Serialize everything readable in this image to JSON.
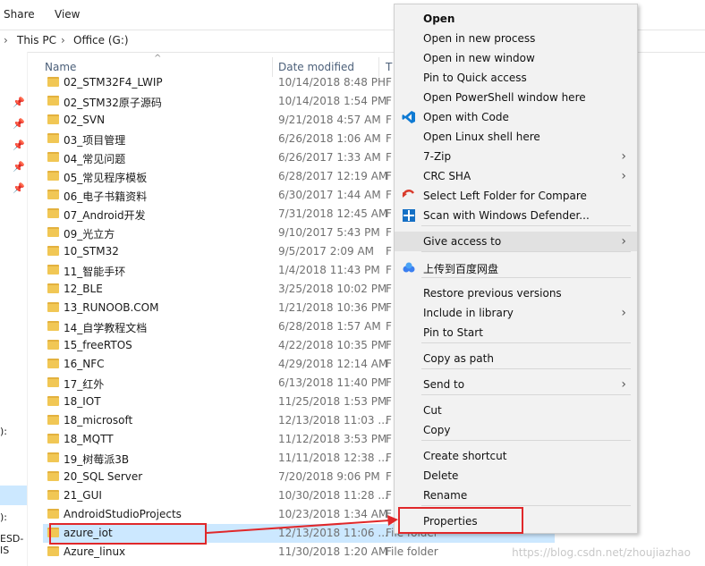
{
  "ribbon": {
    "tabs": [
      "Share",
      "View"
    ]
  },
  "address": {
    "chevron": "›",
    "segments": [
      "This PC",
      "Office (G:)"
    ]
  },
  "nav": {
    "labels": [
      "):",
      "):",
      "ESD-IS"
    ]
  },
  "columns": {
    "name": "Name",
    "date": "Date modified",
    "type": "T"
  },
  "files": [
    {
      "name": "02_STM32F4_LWIP",
      "date": "10/14/2018 8:48 PH",
      "type": "F"
    },
    {
      "name": "02_STM32原子源码",
      "date": "10/14/2018 1:54 PM",
      "type": "F"
    },
    {
      "name": "02_SVN",
      "date": "9/21/2018 4:57 AM",
      "type": "F"
    },
    {
      "name": "03_项目管理",
      "date": "6/26/2018 1:06 AM",
      "type": "F"
    },
    {
      "name": "04_常见问题",
      "date": "6/26/2017 1:33 AM",
      "type": "F"
    },
    {
      "name": "05_常见程序模板",
      "date": "6/28/2017 12:19 AM",
      "type": "F"
    },
    {
      "name": "06_电子书籍资料",
      "date": "6/30/2017 1:44 AM",
      "type": "F"
    },
    {
      "name": "07_Android开发",
      "date": "7/31/2018 12:45 AM",
      "type": "F"
    },
    {
      "name": "09_光立方",
      "date": "9/10/2017 5:43 PM",
      "type": "F"
    },
    {
      "name": "10_STM32",
      "date": "9/5/2017 2:09 AM",
      "type": "F"
    },
    {
      "name": "11_智能手环",
      "date": "1/4/2018 11:43 PM",
      "type": "F"
    },
    {
      "name": "12_BLE",
      "date": "3/25/2018 10:02 PM",
      "type": "F"
    },
    {
      "name": "13_RUNOOB.COM",
      "date": "1/21/2018 10:36 PM",
      "type": "F"
    },
    {
      "name": "14_自学教程文档",
      "date": "6/28/2018 1:57 AM",
      "type": "F"
    },
    {
      "name": "15_freeRTOS",
      "date": "4/22/2018 10:35 PM",
      "type": "F"
    },
    {
      "name": "16_NFC",
      "date": "4/29/2018 12:14 AM",
      "type": "F"
    },
    {
      "name": "17_红外",
      "date": "6/13/2018 11:40 PM",
      "type": "F"
    },
    {
      "name": "18_IOT",
      "date": "11/25/2018 1:53 PM",
      "type": "F"
    },
    {
      "name": "18_microsoft",
      "date": "12/13/2018 11:03 ...",
      "type": "F"
    },
    {
      "name": "18_MQTT",
      "date": "11/12/2018 3:53 PM",
      "type": "F"
    },
    {
      "name": "19_树莓派3B",
      "date": "11/11/2018 12:38 ...",
      "type": "F"
    },
    {
      "name": "20_SQL Server",
      "date": "7/20/2018 9:06 PM",
      "type": "F"
    },
    {
      "name": "21_GUI",
      "date": "10/30/2018 11:28 ...",
      "type": "F"
    },
    {
      "name": "AndroidStudioProjects",
      "date": "10/23/2018 1:34 AM",
      "type": "F"
    },
    {
      "name": "azure_iot",
      "date": "12/13/2018 11:06 ...",
      "type": "File folder",
      "selected": true
    },
    {
      "name": "Azure_linux",
      "date": "11/30/2018 1:20 AM",
      "type": "File folder"
    }
  ],
  "menu": {
    "items": [
      {
        "label": "Open",
        "bold": true
      },
      {
        "label": "Open in new process"
      },
      {
        "label": "Open in new window"
      },
      {
        "label": "Pin to Quick access"
      },
      {
        "label": "Open PowerShell window here"
      },
      {
        "label": "Open with Code",
        "icon": "vscode-icon"
      },
      {
        "label": "Open Linux shell here"
      },
      {
        "label": "7-Zip",
        "submenu": true
      },
      {
        "label": "CRC SHA",
        "submenu": true
      },
      {
        "label": "Select Left Folder for Compare",
        "icon": "compare-icon"
      },
      {
        "label": "Scan with Windows Defender...",
        "icon": "defender-icon"
      },
      {
        "sep": true
      },
      {
        "label": "Give access to",
        "submenu": true,
        "highlight": true
      },
      {
        "sep": true
      },
      {
        "label": "上传到百度网盘",
        "icon": "baidu-cloud-icon"
      },
      {
        "sep": true
      },
      {
        "label": "Restore previous versions"
      },
      {
        "label": "Include in library",
        "submenu": true
      },
      {
        "label": "Pin to Start"
      },
      {
        "sep": true
      },
      {
        "label": "Copy as path"
      },
      {
        "sep": true
      },
      {
        "label": "Send to",
        "submenu": true
      },
      {
        "sep": true
      },
      {
        "label": "Cut"
      },
      {
        "label": "Copy"
      },
      {
        "sep": true
      },
      {
        "label": "Create shortcut"
      },
      {
        "label": "Delete"
      },
      {
        "label": "Rename"
      },
      {
        "sep": true
      },
      {
        "label": "Properties"
      }
    ],
    "submenu_glyph": "›"
  },
  "colors": {
    "annotation": "#e0282a",
    "selection": "#cce8ff",
    "vscode": "#0e7ad3",
    "defender": "#1570c5"
  },
  "watermark": "https://blog.csdn.net/zhoujiazhao"
}
